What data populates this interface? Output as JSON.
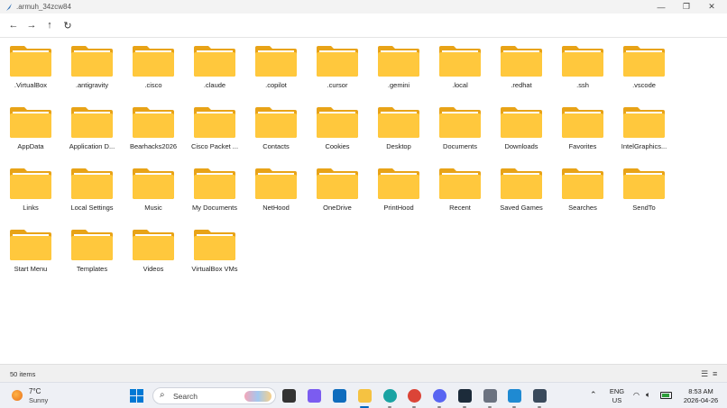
{
  "window": {
    "title": ".armuh_34zcw84",
    "minimize_glyph": "—",
    "restore_glyph": "❐",
    "close_glyph": "✕"
  },
  "toolbar": {
    "back_glyph": "←",
    "forward_glyph": "→",
    "up_glyph": "↑",
    "refresh_glyph": "↻"
  },
  "colors": {
    "folder_body": "#FFC83D",
    "folder_tab": "#E8A317",
    "folder_paper": "#FFFFFF",
    "accent": "#0067C0"
  },
  "folders": [
    ".VirtualBox",
    ".antigravity",
    ".cisco",
    ".claude",
    ".copilot",
    ".cursor",
    ".gemini",
    ".local",
    ".redhat",
    ".ssh",
    ".vscode",
    "AppData",
    "Application D...",
    "Bearhacks2026",
    "Cisco Packet ...",
    "Contacts",
    "Cookies",
    "Desktop",
    "Documents",
    "Downloads",
    "Favorites",
    "IntelGraphics...",
    "Links",
    "Local Settings",
    "Music",
    "My Documents",
    "NetHood",
    "OneDrive",
    "PrintHood",
    "Recent",
    "Saved Games",
    "Searches",
    "SendTo",
    "Start Menu",
    "Templates",
    "Videos",
    "VirtualBox VMs"
  ],
  "status": {
    "item_count": "50 items",
    "details_view_icon": "list-view-icon",
    "tiles_view_icon": "details-view-icon"
  },
  "taskbar": {
    "weather_temp": "7°C",
    "weather_desc": "Sunny",
    "search_placeholder": "Search",
    "language": "ENG",
    "region": "US",
    "time": "8:53 AM",
    "date": "2026-04-26",
    "pinned": [
      {
        "name": "task-view-icon",
        "color": "#333333"
      },
      {
        "name": "copilot-icon",
        "color": "#7b5cf0"
      },
      {
        "name": "outlook-icon",
        "color": "#0f6cbd"
      },
      {
        "name": "file-explorer-icon",
        "color": "#f5c242"
      },
      {
        "name": "edge-icon",
        "color": "#1aa3a3"
      },
      {
        "name": "chrome-icon",
        "color": "#db4437"
      },
      {
        "name": "discord-icon",
        "color": "#5865f2"
      },
      {
        "name": "terminal-app-icon",
        "color": "#1c2b3a"
      },
      {
        "name": "settings-icon",
        "color": "#6b7280"
      },
      {
        "name": "vscode-icon",
        "color": "#1f8ad2"
      },
      {
        "name": "monitor-app-icon",
        "color": "#3a4a5c"
      }
    ]
  }
}
